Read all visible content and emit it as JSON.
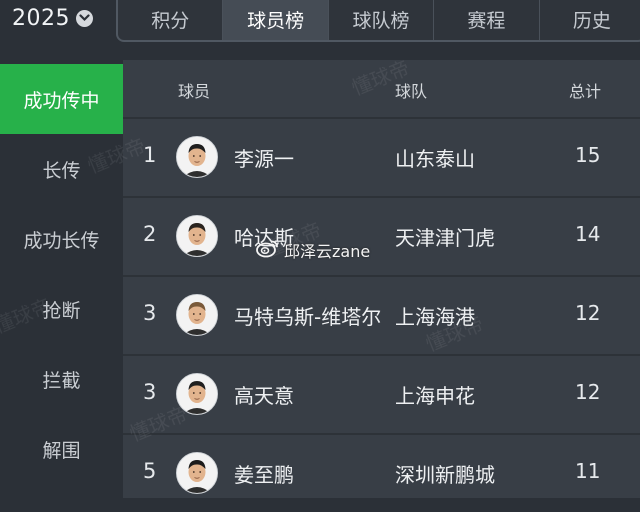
{
  "season": {
    "label": "2025"
  },
  "tabs": [
    {
      "label": "积分"
    },
    {
      "label": "球员榜"
    },
    {
      "label": "球队榜"
    },
    {
      "label": "赛程"
    },
    {
      "label": "历史"
    }
  ],
  "active_tab": "球员榜",
  "sidebar": {
    "items": [
      {
        "label": "成功传中"
      },
      {
        "label": "长传"
      },
      {
        "label": "成功长传"
      },
      {
        "label": "抢断"
      },
      {
        "label": "拦截"
      },
      {
        "label": "解围"
      }
    ],
    "active": "成功传中"
  },
  "table": {
    "headers": {
      "player": "球员",
      "team": "球队",
      "total": "总计"
    },
    "rows": [
      {
        "rank": "1",
        "player": "李源一",
        "team": "山东泰山",
        "total": "15",
        "avatar_icon": "player-avatar-icon"
      },
      {
        "rank": "2",
        "player": "哈达斯",
        "team": "天津津门虎",
        "total": "14",
        "avatar_icon": "player-avatar-icon"
      },
      {
        "rank": "3",
        "player": "马特乌斯-维塔尔",
        "team": "上海海港",
        "total": "12",
        "avatar_icon": "player-avatar-icon"
      },
      {
        "rank": "3",
        "player": "高天意",
        "team": "上海申花",
        "total": "12",
        "avatar_icon": "player-avatar-icon"
      },
      {
        "rank": "5",
        "player": "姜至鹏",
        "team": "深圳新鹏城",
        "total": "11",
        "avatar_icon": "player-avatar-icon"
      }
    ]
  },
  "watermark": {
    "text": "懂球帝"
  },
  "overlay": {
    "weibo_user": "邱泽云zane",
    "icon": "weibo-icon"
  },
  "colors": {
    "accent_green": "#27b14a",
    "background": "#2b3037",
    "table_bg": "#383e46",
    "active_tab_bg": "#454c55"
  }
}
